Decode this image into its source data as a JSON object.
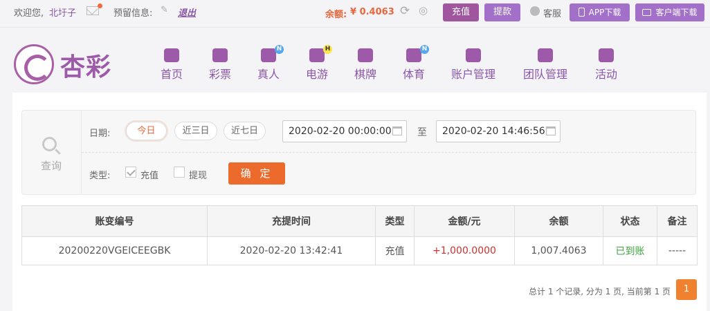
{
  "topbar": {
    "welcome": "欢迎您,",
    "username": "北圩子",
    "reserve_info": "预留信息:",
    "logout": "退出",
    "balance_label": "余额:",
    "balance_value": "¥ 0.4063",
    "recharge": "充值",
    "withdraw": "提款",
    "service": "客服",
    "app_download": "APP下载",
    "client_download": "客户端下载"
  },
  "brand": {
    "name": "杏彩"
  },
  "nav": [
    {
      "label": "首页",
      "icon": "home-icon"
    },
    {
      "label": "彩票",
      "icon": "ticket-icon"
    },
    {
      "label": "真人",
      "icon": "live-dealer-icon",
      "badge": "N"
    },
    {
      "label": "电游",
      "icon": "gamepad-icon",
      "badge": "H"
    },
    {
      "label": "棋牌",
      "icon": "cards-icon"
    },
    {
      "label": "体育",
      "icon": "trophy-icon",
      "badge": "N"
    },
    {
      "label": "账户管理",
      "icon": "account-icon"
    },
    {
      "label": "团队管理",
      "icon": "team-icon"
    },
    {
      "label": "活动",
      "icon": "gift-icon"
    }
  ],
  "query": {
    "label": "查询",
    "date_label": "日期:",
    "presets": [
      "今日",
      "近三日",
      "近七日"
    ],
    "active_preset": "今日",
    "start": "2020-02-20 00:00:00",
    "to": "至",
    "end": "2020-02-20 14:46:56",
    "type_label": "类型:",
    "types": [
      {
        "label": "充值",
        "checked": true
      },
      {
        "label": "提现",
        "checked": false
      }
    ],
    "confirm": "确 定"
  },
  "table": {
    "columns": [
      "账变编号",
      "充提时间",
      "类型",
      "金额/元",
      "余额",
      "状态",
      "备注"
    ],
    "rows": [
      [
        "20200220VGEICEEGBK",
        "2020-02-20 13:42:41",
        "充值",
        "+1,000.0000",
        "1,007.4063",
        "已到账",
        "-----"
      ]
    ]
  },
  "pagination": {
    "summary": "总计 1 个记录, 分为 1 页, 当前第 1 页",
    "current_page": "1"
  },
  "colors": {
    "brand_purple": "#9d5aa8",
    "accent_orange": "#ec6a2c",
    "amount_red": "#c9302c",
    "status_green": "#3fa33f"
  }
}
